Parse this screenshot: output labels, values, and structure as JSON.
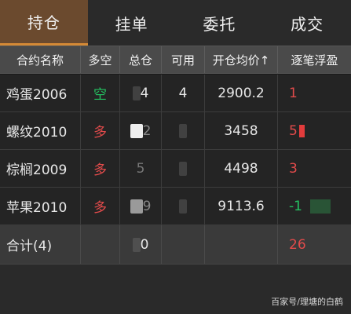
{
  "tabs": [
    "持仓",
    "挂单",
    "委托",
    "成交"
  ],
  "columns": [
    "合约名称",
    "多空",
    "总仓",
    "可用",
    "开仓均价↑",
    "逐笔浮盈"
  ],
  "rows": [
    {
      "name": "鸡蛋2006",
      "side": "空",
      "side_color": "#24c261",
      "total": "4",
      "avail": "4",
      "price": "2900.2",
      "pnl": "1",
      "pnl_color": "#e24b4b"
    },
    {
      "name": "螺纹2010",
      "side": "多",
      "side_color": "#e24b4b",
      "total": "2",
      "avail": "",
      "price": "3458",
      "pnl": "5",
      "pnl_color": "#e24b4b"
    },
    {
      "name": "棕榈2009",
      "side": "多",
      "side_color": "#e24b4b",
      "total": "5",
      "avail": "",
      "price": "4498",
      "pnl": "3",
      "pnl_color": "#e24b4b"
    },
    {
      "name": "苹果2010",
      "side": "多",
      "side_color": "#e24b4b",
      "total": "9",
      "avail": "",
      "price": "9113.6",
      "pnl": "-1",
      "pnl_color": "#24c261"
    }
  ],
  "total": {
    "label": "合计(4)",
    "total": "0",
    "pnl": "26",
    "pnl_color": "#e24b4b"
  },
  "watermark": "百家号/理塘的白鹤"
}
